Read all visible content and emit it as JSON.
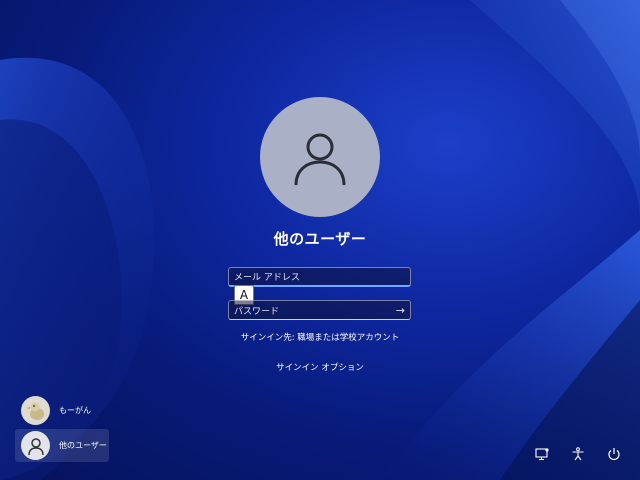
{
  "user": {
    "display_name": "他のユーザー"
  },
  "form": {
    "email_placeholder": "メール アドレス",
    "password_placeholder": "パスワード",
    "ime_mode": "A",
    "signin_to": "サインイン先: 職場または学校アカウント",
    "signin_options": "サインイン オプション"
  },
  "users": [
    {
      "name": "もーがん",
      "icon": "duck-avatar"
    },
    {
      "name": "他のユーザー",
      "icon": "person-icon"
    }
  ],
  "tray": {
    "icons": [
      "network-icon",
      "accessibility-icon",
      "power-icon"
    ]
  },
  "colors": {
    "background": "#0b20a0",
    "accent": "#6fa8ff"
  }
}
